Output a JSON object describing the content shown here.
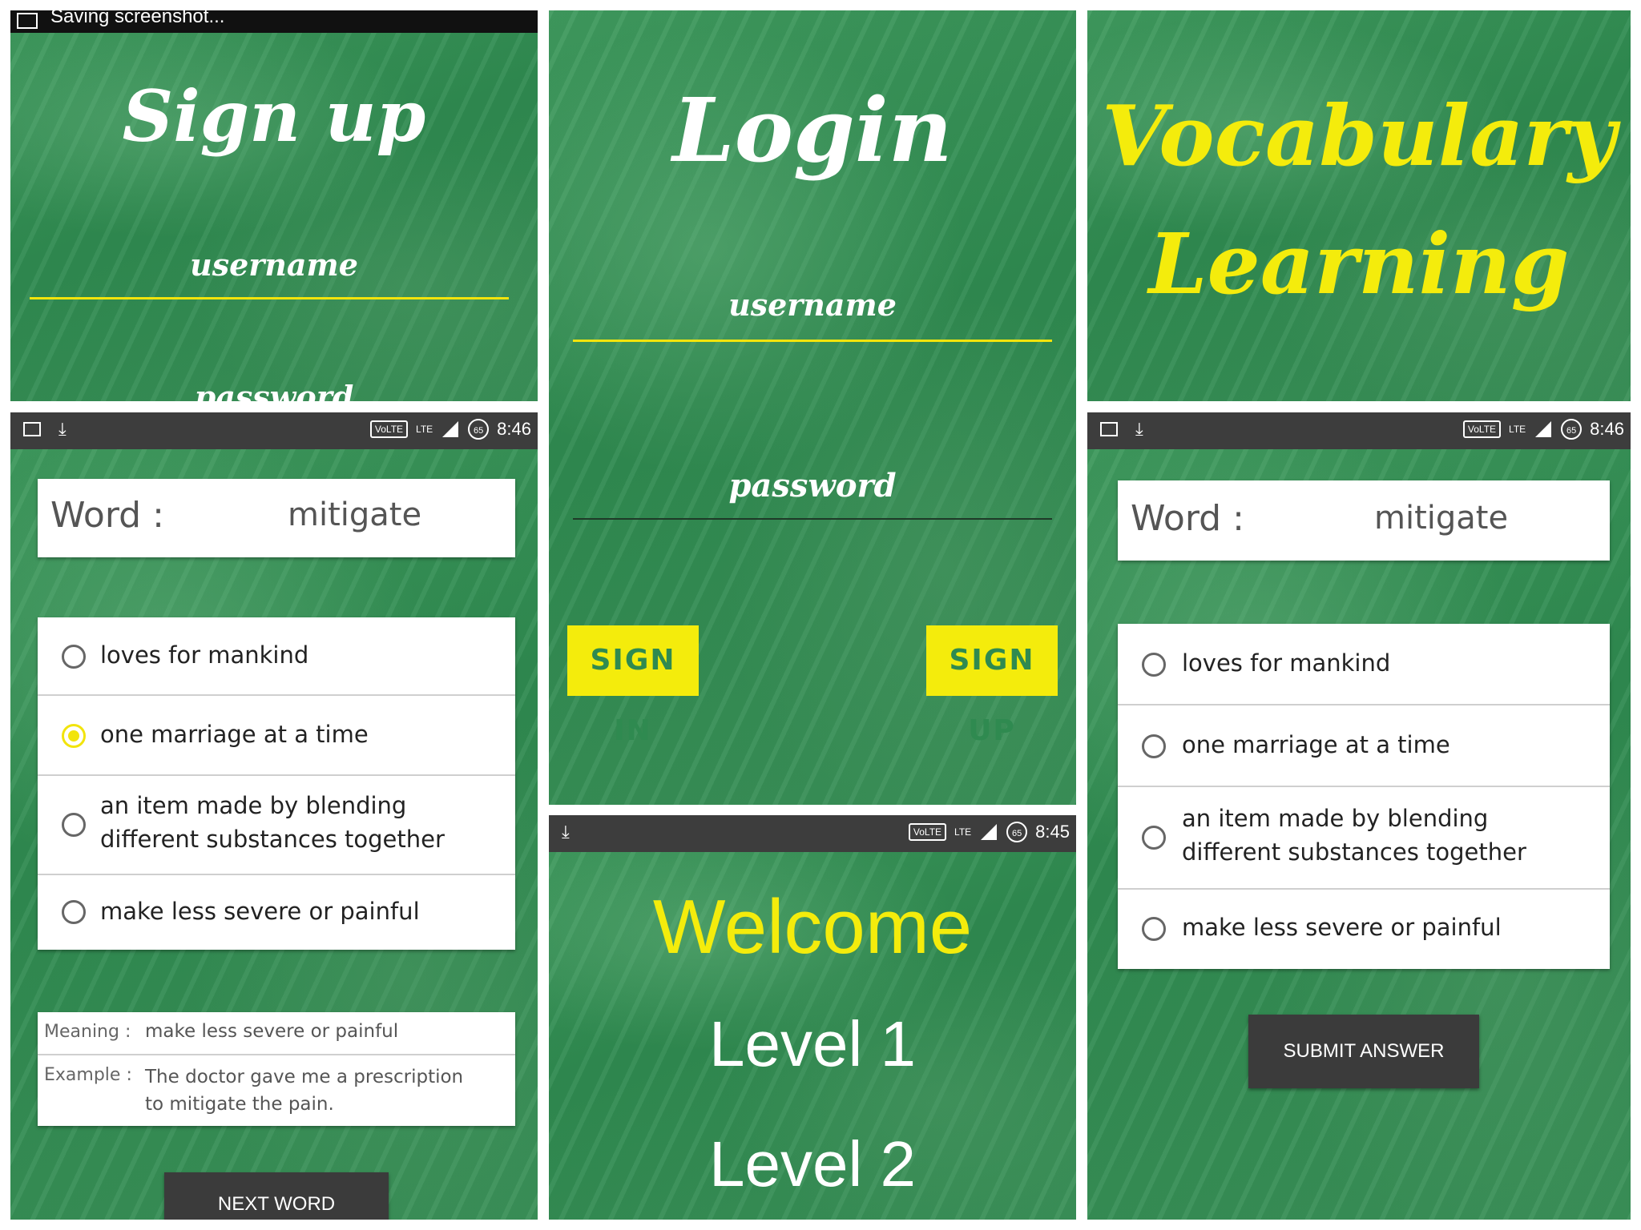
{
  "signup_panel": {
    "notification": "Saving screenshot...",
    "title": "Sign up",
    "username_hint": "username",
    "password_hint": "password"
  },
  "login_panel": {
    "title": "Login",
    "username_hint": "username",
    "password_hint": "password",
    "sign_in_label": "SIGN IN",
    "sign_up_label": "SIGN UP"
  },
  "splash_panel": {
    "title_line1": "Vocabulary",
    "title_line2": "Learning"
  },
  "status_bar": {
    "volte": "VoLTE",
    "lte": "LTE",
    "battery": "65",
    "time_quiz": "8:46",
    "time_welcome": "8:45"
  },
  "quiz_answered": {
    "word_label": "Word :",
    "word_value": "mitigate",
    "options": [
      {
        "text": "loves for mankind",
        "selected": false
      },
      {
        "text": "one marriage at a time",
        "selected": true
      },
      {
        "text": "an item made by blending different substances together",
        "selected": false
      },
      {
        "text": "make less severe or painful",
        "selected": false
      }
    ],
    "meaning_label": "Meaning :",
    "meaning_value": "make less severe or painful",
    "example_label": "Example :",
    "example_value": "The doctor gave me a prescription to mitigate the pain.",
    "next_button": "NEXT WORD"
  },
  "welcome_panel": {
    "title": "Welcome",
    "levels": [
      "Level 1",
      "Level 2"
    ]
  },
  "quiz_unanswered": {
    "word_label": "Word :",
    "word_value": "mitigate",
    "options": [
      {
        "text": "loves for mankind",
        "selected": false
      },
      {
        "text": "one marriage at a time",
        "selected": false
      },
      {
        "text": "an item made by blending different substances together",
        "selected": false
      },
      {
        "text": "make less severe or painful",
        "selected": false
      }
    ],
    "submit_button": "SUBMIT ANSWER"
  },
  "colors": {
    "chalkboard": "#2f8a50",
    "accent_yellow": "#f4ec0c",
    "status_bar": "#3d3d3d",
    "button_dark": "#3b3b3b"
  }
}
